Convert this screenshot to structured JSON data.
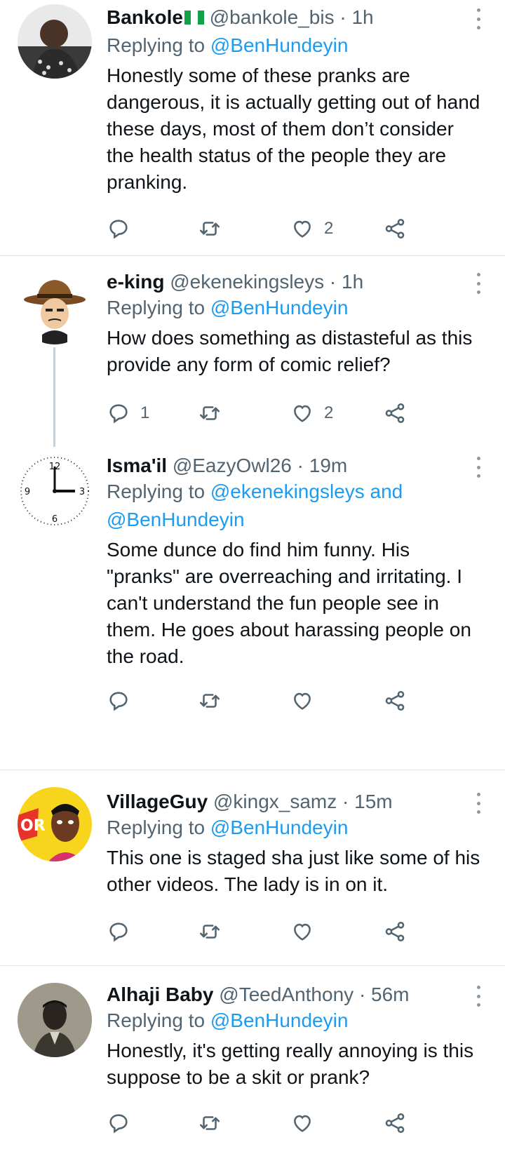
{
  "tweets": [
    {
      "name": "Bankole",
      "handle": "@bankole_bis",
      "time": "· 1h",
      "replying_prefix": "Replying to",
      "replying_to": "@BenHundeyin",
      "text": "Honestly some of these pranks are dangerous, it is actually getting out of hand these days, most of them don’t consider the health status of the people they are pranking.",
      "counts": {
        "reply": "",
        "retweet": "",
        "like": "2"
      }
    },
    {
      "name": "e-king",
      "handle": "@ekenekingsleys",
      "time": "· 1h",
      "replying_prefix": "Replying to",
      "replying_to": "@BenHundeyin",
      "text": "How does something as distasteful as this provide any form of comic relief?",
      "counts": {
        "reply": "1",
        "retweet": "",
        "like": "2"
      }
    },
    {
      "name": "Isma'il",
      "handle": "@EazyOwl26",
      "time": "· 19m",
      "replying_prefix": "Replying to",
      "replying_to": "@ekenekingsleys and @BenHundeyin",
      "text": "Some dunce do find him funny. His \"pranks\" are overreaching and irritating. I can't understand the fun people see in them. He goes about harassing people on the road.",
      "counts": {
        "reply": "",
        "retweet": "",
        "like": ""
      }
    },
    {
      "name": "VillageGuy",
      "handle": "@kingx_samz",
      "time": "· 15m",
      "replying_prefix": "Replying to",
      "replying_to": "@BenHundeyin",
      "text": "This one is staged sha just like some of his other videos. The lady is in on it.",
      "counts": {
        "reply": "",
        "retweet": "",
        "like": ""
      }
    },
    {
      "name": "Alhaji Baby",
      "handle": "@TeedAnthony",
      "time": "· 56m",
      "replying_prefix": "Replying to",
      "replying_to": "@BenHundeyin",
      "text": "Honestly, it's getting really annoying is this suppose to be a skit or prank?",
      "counts": {
        "reply": "",
        "retweet": "",
        "like": ""
      }
    }
  ],
  "icons": {
    "reply": "reply-icon",
    "retweet": "retweet-icon",
    "like": "heart-icon",
    "share": "share-icon",
    "more": "more-vertical-icon",
    "flag": "nigeria-flag-icon"
  },
  "colors": {
    "mention": "#1d9bf0",
    "secondary": "#536471",
    "text": "#0f1419",
    "divider": "#e3e6e8"
  }
}
